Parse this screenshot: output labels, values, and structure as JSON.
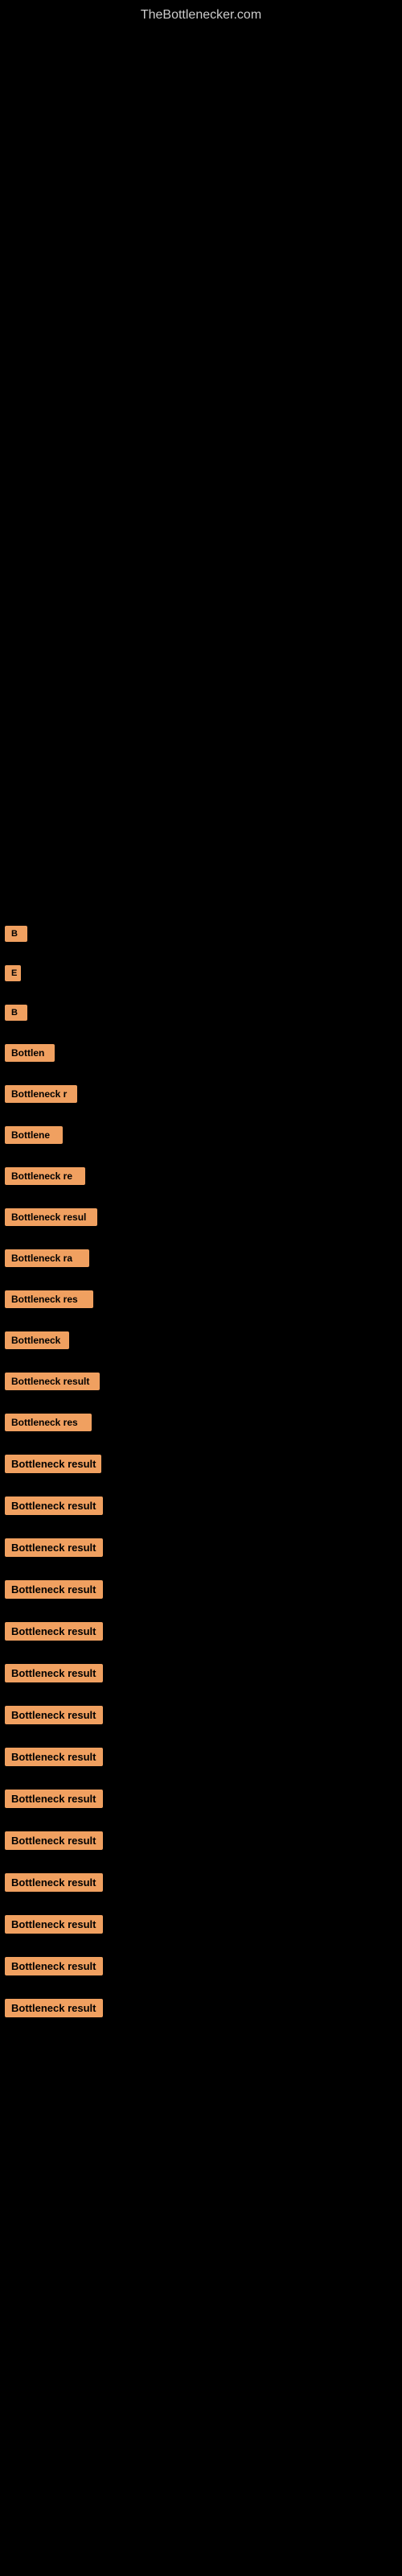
{
  "header": {
    "site_title": "TheBottlenecker.com"
  },
  "rows": [
    {
      "id": "b1",
      "label": "B",
      "class": "row-b1"
    },
    {
      "id": "e1",
      "label": "E",
      "class": "row-e1"
    },
    {
      "id": "b2",
      "label": "B",
      "class": "row-b2"
    },
    {
      "id": "bottlen1",
      "label": "Bottlen",
      "class": "row-bottlen1"
    },
    {
      "id": "bottleneck-r1",
      "label": "Bottleneck r",
      "class": "row-bottleneck-r1"
    },
    {
      "id": "bottlene1",
      "label": "Bottlene",
      "class": "row-bottlene1"
    },
    {
      "id": "bottleneck-re1",
      "label": "Bottleneck re",
      "class": "row-bottleneck-re1"
    },
    {
      "id": "bottleneck-resul1",
      "label": "Bottleneck resul",
      "class": "row-bottleneck-resul1"
    },
    {
      "id": "bottleneck-ra1",
      "label": "Bottleneck ra",
      "class": "row-bottleneck-ra1"
    },
    {
      "id": "bottleneck-res1",
      "label": "Bottleneck res",
      "class": "row-bottleneck-res1"
    },
    {
      "id": "bottleneck1",
      "label": "Bottleneck",
      "class": "row-bottleneck1"
    },
    {
      "id": "bottleneck-result1",
      "label": "Bottleneck result",
      "class": "row-bottleneck-result1"
    },
    {
      "id": "bottleneck-res2",
      "label": "Bottleneck res",
      "class": "row-bottleneck-res2"
    },
    {
      "id": "bottleneck-result2",
      "label": "Bottleneck result",
      "class": "row-bottleneck-result2"
    },
    {
      "id": "bottleneck-result3",
      "label": "Bottleneck result",
      "class": "row-bottleneck-result3"
    },
    {
      "id": "bottleneck-result4",
      "label": "Bottleneck result",
      "class": "row-bottleneck-result4"
    },
    {
      "id": "bottleneck-result5",
      "label": "Bottleneck result",
      "class": "row-bottleneck-result5"
    },
    {
      "id": "bottleneck-result6",
      "label": "Bottleneck result",
      "class": "row-bottleneck-result6"
    },
    {
      "id": "bottleneck-result7",
      "label": "Bottleneck result",
      "class": "row-bottleneck-result7"
    },
    {
      "id": "bottleneck-result8",
      "label": "Bottleneck result",
      "class": "row-bottleneck-result8"
    },
    {
      "id": "bottleneck-result9",
      "label": "Bottleneck result",
      "class": "row-bottleneck-result9"
    },
    {
      "id": "bottleneck-result10",
      "label": "Bottleneck result",
      "class": "row-bottleneck-result10"
    },
    {
      "id": "bottleneck-result11",
      "label": "Bottleneck result",
      "class": "row-bottleneck-result11"
    },
    {
      "id": "bottleneck-result12",
      "label": "Bottleneck result",
      "class": "row-bottleneck-result12"
    },
    {
      "id": "bottleneck-result13",
      "label": "Bottleneck result",
      "class": "row-bottleneck-result13"
    },
    {
      "id": "bottleneck-result14",
      "label": "Bottleneck result",
      "class": "row-bottleneck-result14"
    },
    {
      "id": "bottleneck-result15",
      "label": "Bottleneck result",
      "class": "row-bottleneck-result15"
    }
  ]
}
